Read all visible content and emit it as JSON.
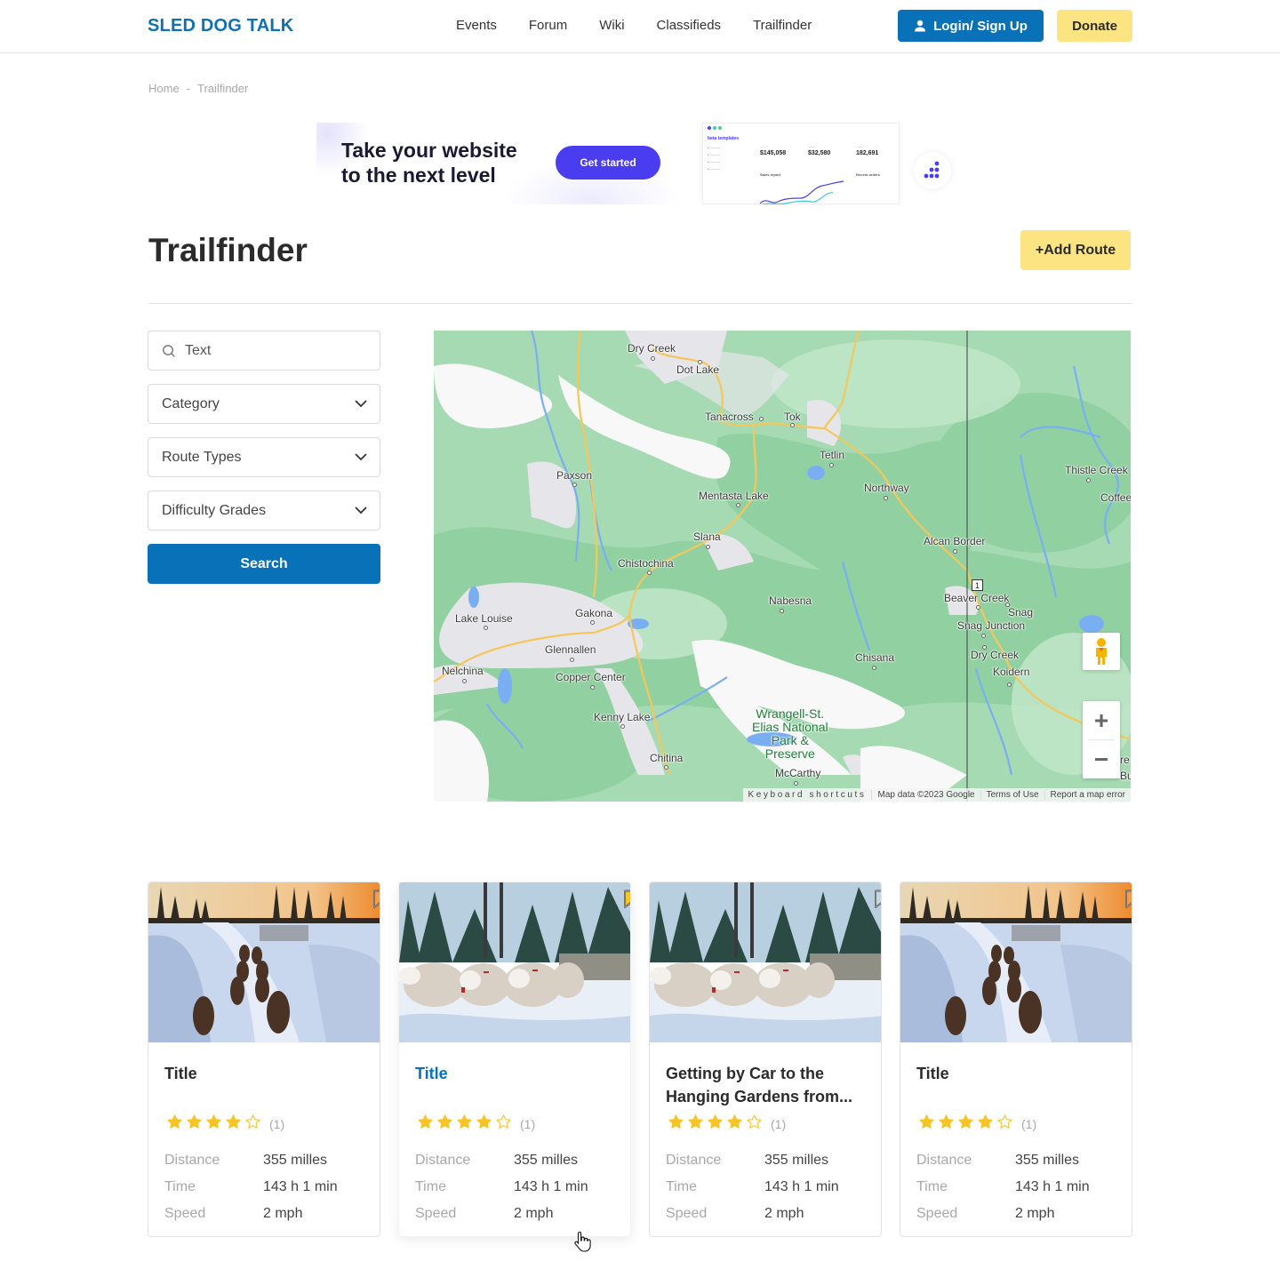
{
  "header": {
    "logo": "SLED DOG TALK",
    "nav": [
      "Events",
      "Forum",
      "Wiki",
      "Classifieds",
      "Trailfinder"
    ],
    "login_label": "Login/ Sign Up",
    "donate_label": "Donate"
  },
  "breadcrumb": {
    "items": [
      "Home",
      "Trailfinder"
    ],
    "separator": "-"
  },
  "ad": {
    "headline_line1": "Take your website",
    "headline_line2": "to the next level",
    "cta": "Get started",
    "dash_brand": "beta templates",
    "dash_metrics": [
      "$145,058",
      "$32,580",
      "182,691"
    ],
    "dash_sales_report": "Sales report",
    "dash_recent_orders": "Recent orders"
  },
  "page": {
    "title": "Trailfinder",
    "add_route_label": "+Add Route"
  },
  "filters": {
    "search_placeholder": "Text",
    "category": "Category",
    "route_types": "Route Types",
    "difficulty": "Difficulty Grades",
    "search_button": "Search"
  },
  "map": {
    "labels": [
      {
        "name": "Dry Creek"
      },
      {
        "name": "Dot Lake"
      },
      {
        "name": "Tanacross"
      },
      {
        "name": "Tok"
      },
      {
        "name": "Tetlin"
      },
      {
        "name": "Paxson"
      },
      {
        "name": "Mentasta Lake"
      },
      {
        "name": "Northway"
      },
      {
        "name": "Slana"
      },
      {
        "name": "Chistochina"
      },
      {
        "name": "Alcan Border"
      },
      {
        "name": "Thistle Creek"
      },
      {
        "name": "Coffee"
      },
      {
        "name": "Nabesna"
      },
      {
        "name": "Gakona"
      },
      {
        "name": "Lake Louise"
      },
      {
        "name": "Beaver Creek"
      },
      {
        "name": "Snag"
      },
      {
        "name": "Snag Junction"
      },
      {
        "name": "Glennallen"
      },
      {
        "name": "Nelchina"
      },
      {
        "name": "Copper Center"
      },
      {
        "name": "Chisana"
      },
      {
        "name": "Dry Creek"
      },
      {
        "name": "Koidern"
      },
      {
        "name": "Kenny Lake"
      },
      {
        "name": "Chitina"
      },
      {
        "name": "McCarthy"
      },
      {
        "name": "Bu"
      },
      {
        "name": "re"
      }
    ],
    "park_label": [
      "Wrangell-St.",
      "Elias National",
      "Park &",
      "Preserve"
    ],
    "route_shield": "1",
    "footer": [
      "Keyboard shortcuts",
      "Map data ©2023 Google",
      "Terms of Use",
      "Report a map error"
    ],
    "zoom_in": "+",
    "zoom_out": "−"
  },
  "cards": [
    {
      "title": "Title",
      "rating": 4,
      "max_rating": 5,
      "review_count": "(1)",
      "bookmarked": false,
      "image": "sled-dogs-trail-sunset",
      "stats": [
        {
          "label": "Distance",
          "value": "355 milles"
        },
        {
          "label": "Time",
          "value": "143 h 1 min"
        },
        {
          "label": "Speed",
          "value": "2 mph"
        }
      ]
    },
    {
      "title": "Title",
      "rating": 4,
      "max_rating": 5,
      "review_count": "(1)",
      "bookmarked": true,
      "image": "huskies-running-snow",
      "stats": [
        {
          "label": "Distance",
          "value": "355 milles"
        },
        {
          "label": "Time",
          "value": "143 h 1 min"
        },
        {
          "label": "Speed",
          "value": "2 mph"
        }
      ]
    },
    {
      "title": "Getting by Car to the Hanging Gardens from...",
      "rating": 4,
      "max_rating": 5,
      "review_count": "(1)",
      "bookmarked": false,
      "image": "huskies-running-snow",
      "stats": [
        {
          "label": "Distance",
          "value": "355 milles"
        },
        {
          "label": "Time",
          "value": "143 h 1 min"
        },
        {
          "label": "Speed",
          "value": "2 mph"
        }
      ]
    },
    {
      "title": "Title",
      "rating": 4,
      "max_rating": 5,
      "review_count": "(1)",
      "bookmarked": false,
      "image": "sled-dogs-trail-sunset",
      "stats": [
        {
          "label": "Distance",
          "value": "355 milles"
        },
        {
          "label": "Time",
          "value": "143 h 1 min"
        },
        {
          "label": "Speed",
          "value": "2 mph"
        }
      ]
    }
  ],
  "colors": {
    "brand_blue": "#0871b7",
    "accent_yellow": "#fde482",
    "star_yellow": "#f7c325",
    "ad_purple": "#4a3df0"
  }
}
